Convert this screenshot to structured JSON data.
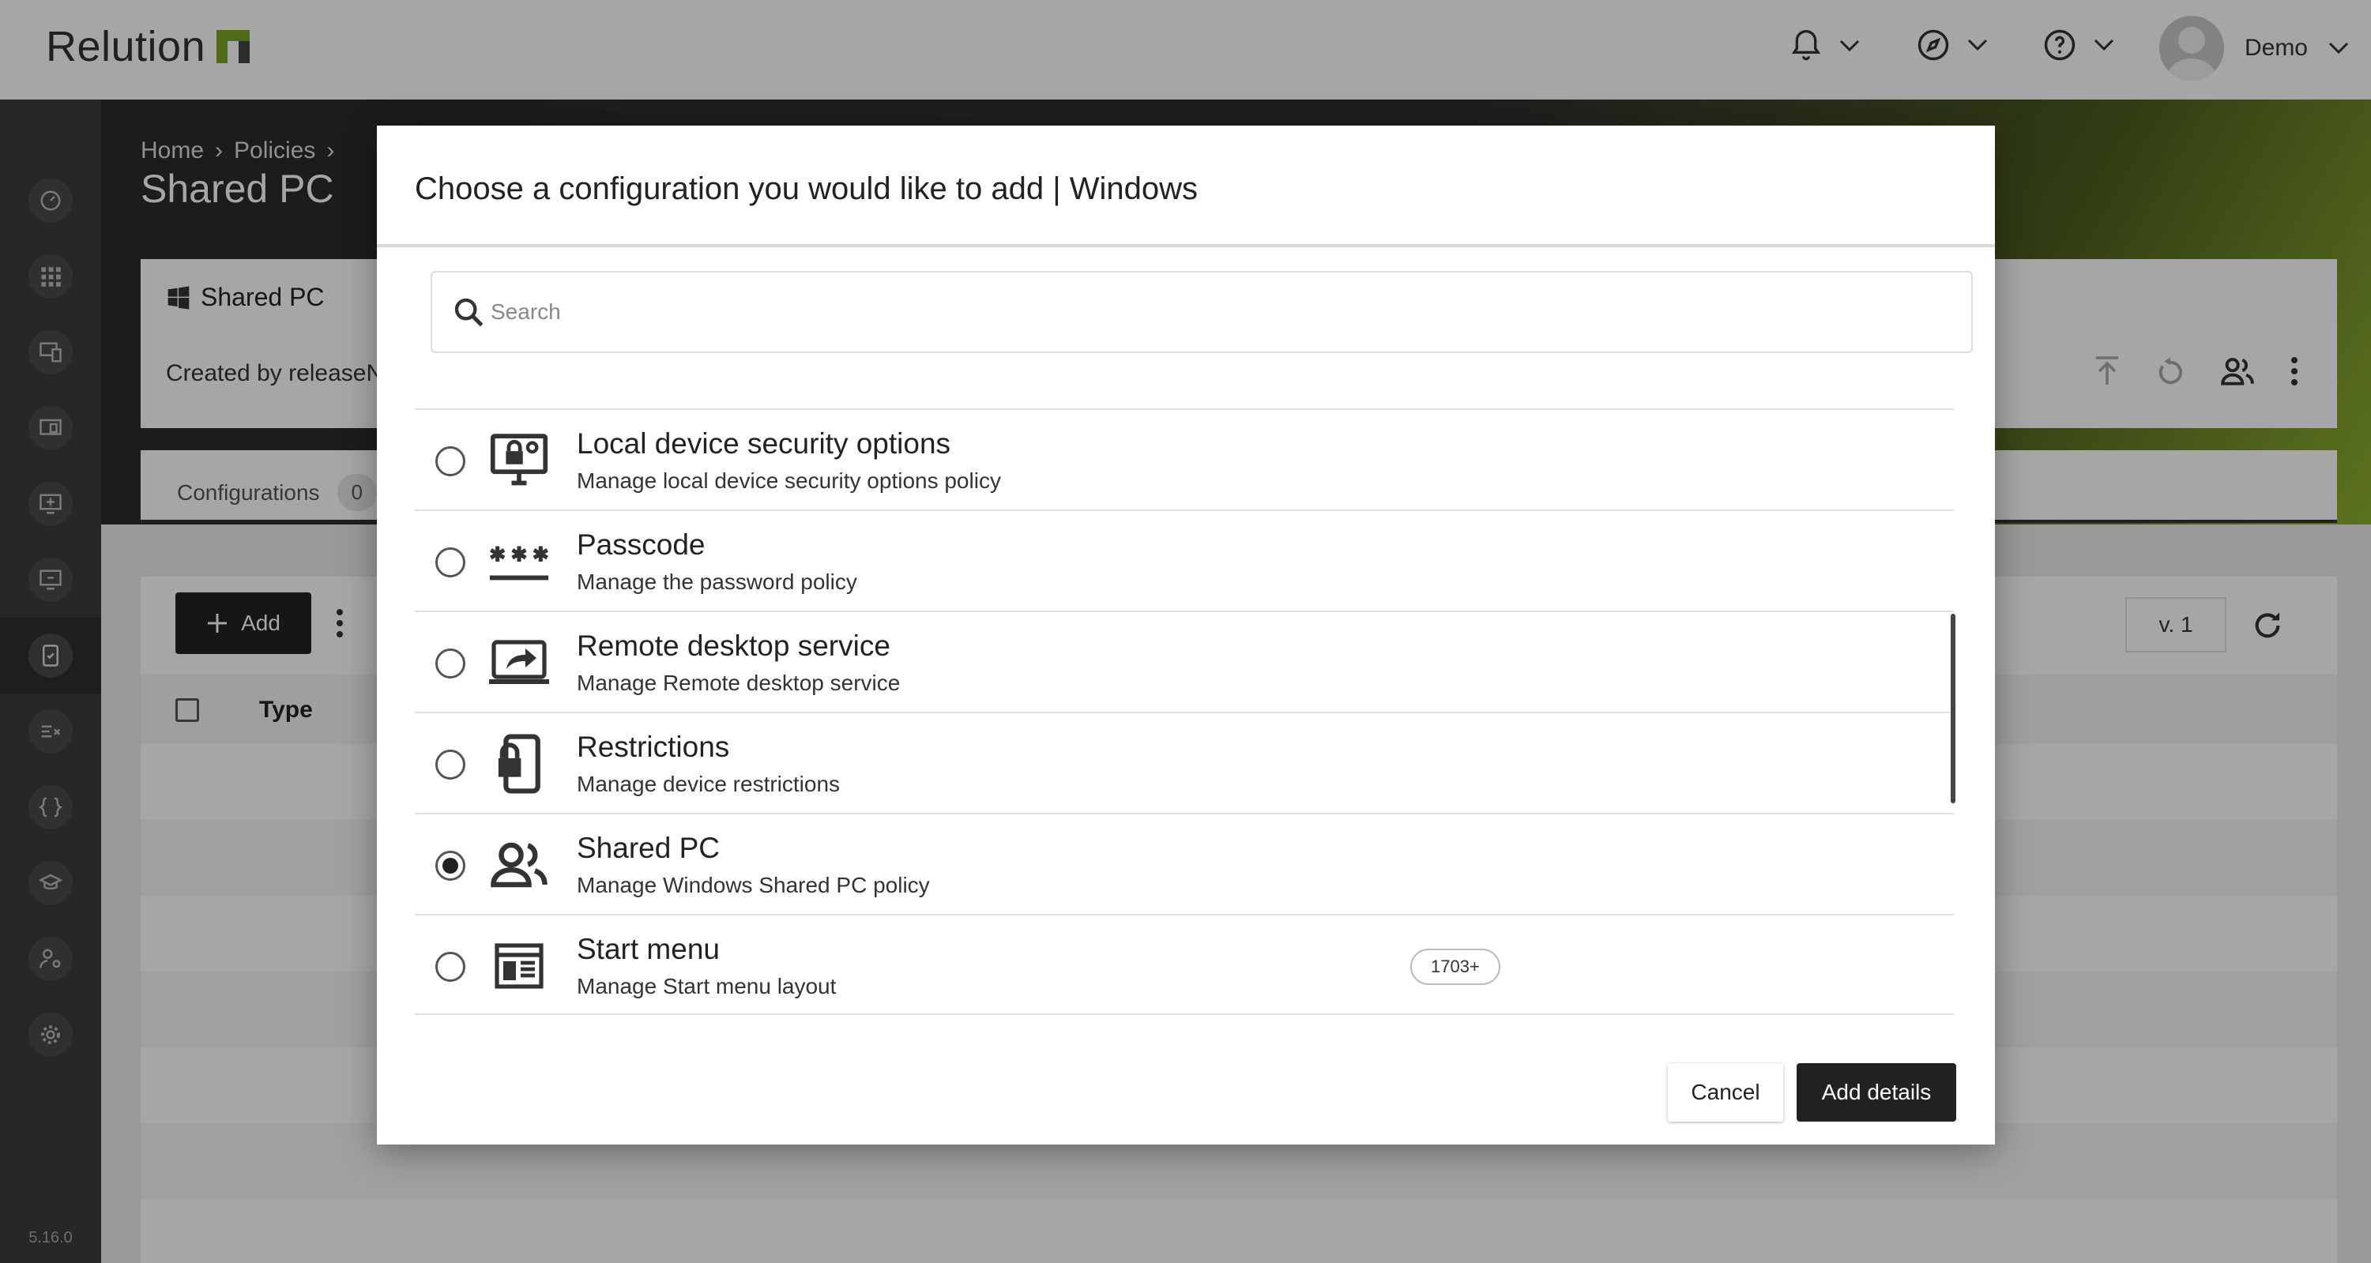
{
  "app": {
    "brand": "Relution",
    "user_name": "Demo",
    "version": "5.16.0"
  },
  "page": {
    "breadcrumb": [
      "Home",
      "Policies"
    ],
    "title": "Shared PC"
  },
  "policy_card": {
    "name": "Shared PC",
    "created_by": "Created by releaseNo"
  },
  "tabs": {
    "configurations_label": "Configurations",
    "configurations_count": "0"
  },
  "list": {
    "add_label": "Add",
    "version_label": "v. 1",
    "column_type": "Type"
  },
  "modal": {
    "title": "Choose a configuration you would like to add | Windows",
    "search_placeholder": "Search",
    "options": [
      {
        "title": "Local device security options",
        "description": "Manage local device security options policy",
        "icon": "monitor-lock-icon",
        "selected": false,
        "badge": ""
      },
      {
        "title": "Passcode",
        "description": "Manage the password policy",
        "icon": "passcode-icon",
        "selected": false,
        "badge": ""
      },
      {
        "title": "Remote desktop service",
        "description": "Manage Remote desktop service",
        "icon": "remote-desktop-icon",
        "selected": false,
        "badge": ""
      },
      {
        "title": "Restrictions",
        "description": "Manage device restrictions",
        "icon": "device-lock-icon",
        "selected": false,
        "badge": ""
      },
      {
        "title": "Shared PC",
        "description": "Manage Windows Shared PC policy",
        "icon": "people-icon",
        "selected": true,
        "badge": ""
      },
      {
        "title": "Start menu",
        "description": "Manage Start menu layout",
        "icon": "start-menu-icon",
        "selected": false,
        "badge": "1703+"
      }
    ],
    "cancel_label": "Cancel",
    "confirm_label": "Add details"
  },
  "colors": {
    "dark": "#222222",
    "sidebar": "#3c3c3c",
    "accent_green": "#8fb030",
    "overlay": "rgba(0,0,0,0.35)"
  }
}
